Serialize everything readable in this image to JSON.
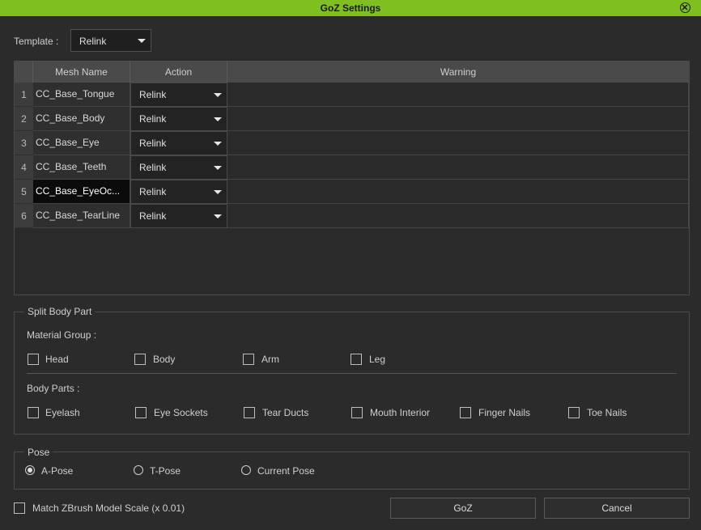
{
  "window": {
    "title": "GoZ Settings"
  },
  "template": {
    "label": "Template :",
    "value": "Relink"
  },
  "table": {
    "headers": {
      "mesh_name": "Mesh Name",
      "action": "Action",
      "warning": "Warning"
    },
    "rows": [
      {
        "num": "1",
        "mesh": "CC_Base_Tongue",
        "action": "Relink",
        "warning": ""
      },
      {
        "num": "2",
        "mesh": "CC_Base_Body",
        "action": "Relink",
        "warning": ""
      },
      {
        "num": "3",
        "mesh": "CC_Base_Eye",
        "action": "Relink",
        "warning": ""
      },
      {
        "num": "4",
        "mesh": "CC_Base_Teeth",
        "action": "Relink",
        "warning": ""
      },
      {
        "num": "5",
        "mesh": "CC_Base_EyeOc...",
        "action": "Relink",
        "warning": ""
      },
      {
        "num": "6",
        "mesh": "CC_Base_TearLine",
        "action": "Relink",
        "warning": ""
      }
    ]
  },
  "split_body_part": {
    "title": "Split Body Part",
    "material_group": {
      "label": "Material Group :",
      "items": [
        {
          "label": "Head",
          "checked": false
        },
        {
          "label": "Body",
          "checked": false
        },
        {
          "label": "Arm",
          "checked": false
        },
        {
          "label": "Leg",
          "checked": false
        }
      ]
    },
    "body_parts": {
      "label": "Body Parts :",
      "items": [
        {
          "label": "Eyelash",
          "checked": false
        },
        {
          "label": "Eye Sockets",
          "checked": false
        },
        {
          "label": "Tear Ducts",
          "checked": false
        },
        {
          "label": "Mouth Interior",
          "checked": false
        },
        {
          "label": "Finger Nails",
          "checked": false
        },
        {
          "label": "Toe Nails",
          "checked": false
        }
      ]
    }
  },
  "pose": {
    "title": "Pose",
    "options": [
      {
        "label": "A-Pose",
        "selected": true
      },
      {
        "label": "T-Pose",
        "selected": false
      },
      {
        "label": "Current Pose",
        "selected": false
      }
    ]
  },
  "match_scale": {
    "label": "Match ZBrush Model Scale (x 0.01)",
    "checked": false
  },
  "buttons": {
    "goz": "GoZ",
    "cancel": "Cancel"
  },
  "colors": {
    "title_bar": "#7fbf1f",
    "background": "#2b2b2b"
  }
}
